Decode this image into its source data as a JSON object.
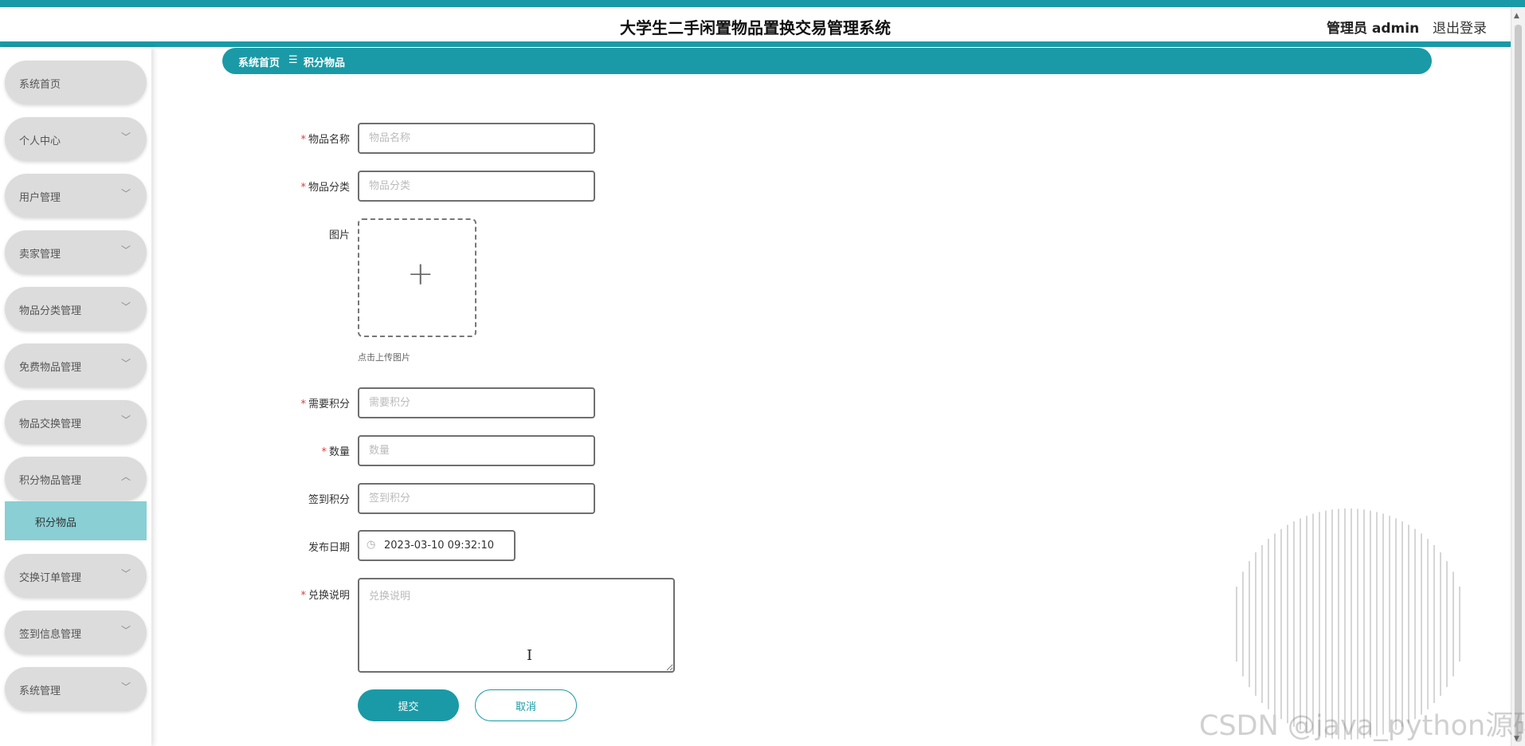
{
  "header": {
    "title": "大学生二手闲置物品置换交易管理系统",
    "user": "管理员 admin",
    "logout": "退出登录"
  },
  "sidebar": {
    "items": [
      {
        "label": "系统首页"
      },
      {
        "label": "个人中心"
      },
      {
        "label": "用户管理"
      },
      {
        "label": "卖家管理"
      },
      {
        "label": "物品分类管理"
      },
      {
        "label": "免费物品管理"
      },
      {
        "label": "物品交换管理"
      },
      {
        "label": "积分物品管理"
      },
      {
        "label": "交换订单管理"
      },
      {
        "label": "签到信息管理"
      },
      {
        "label": "系统管理"
      }
    ],
    "sub_items": [
      {
        "label": "积分物品"
      }
    ]
  },
  "breadcrumb": {
    "home": "系统首页",
    "separator": "☰",
    "current": "积分物品"
  },
  "form": {
    "name": {
      "label": "物品名称",
      "placeholder": "物品名称"
    },
    "category": {
      "label": "物品分类",
      "placeholder": "物品分类"
    },
    "image": {
      "label": "图片",
      "hint": "点击上传图片"
    },
    "points": {
      "label": "需要积分",
      "placeholder": "需要积分"
    },
    "quantity": {
      "label": "数量",
      "placeholder": "数量"
    },
    "checkin_points": {
      "label": "签到积分",
      "placeholder": "签到积分"
    },
    "publish_date": {
      "label": "发布日期",
      "value": "2023-03-10 09:32:10"
    },
    "description": {
      "label": "兑换说明",
      "placeholder": "兑换说明"
    },
    "submit": "提交",
    "cancel": "取消"
  },
  "watermark": "CSDN @java_python源码",
  "colors": {
    "accent": "#1a9aa6",
    "submenu_active": "#89cfd3",
    "menu_bg": "#dcdcdc",
    "required": "#e23b3b"
  }
}
